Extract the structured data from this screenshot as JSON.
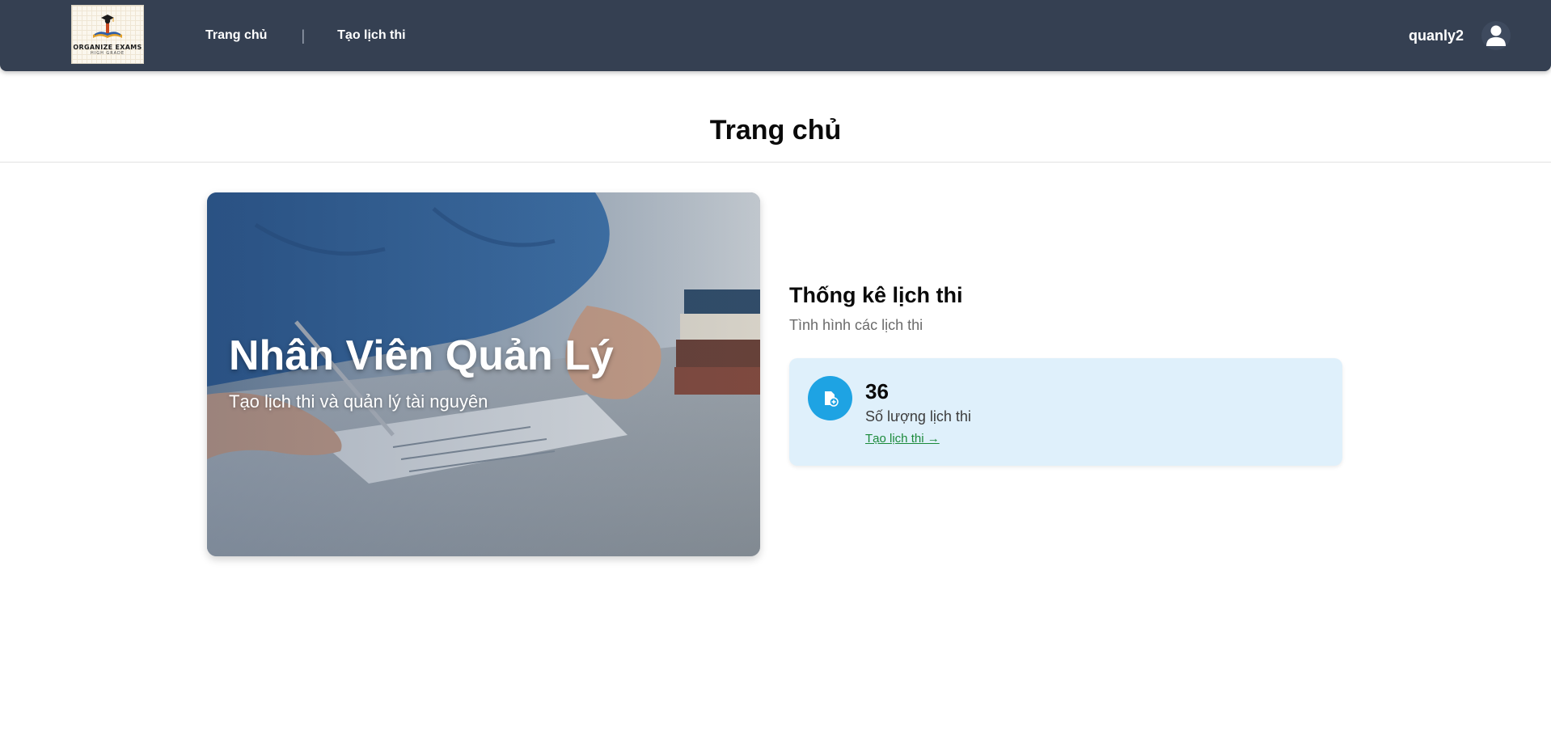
{
  "header": {
    "logo": {
      "title": "ORGANIZE EXAMS",
      "subtitle": "HIGH GRADE"
    },
    "nav": [
      {
        "label": "Trang chủ"
      },
      {
        "label": "Tạo lịch thi"
      }
    ],
    "separator": "|",
    "user": {
      "name": "quanly2",
      "icon": "user-icon"
    },
    "colors": {
      "background": "#354052",
      "text": "#ffffff"
    }
  },
  "page": {
    "title": "Trang chủ"
  },
  "hero": {
    "title": "Nhân Viên Quản Lý",
    "subtitle": "Tạo lịch thi và quản lý tài nguyên"
  },
  "stats": {
    "title": "Thống kê lịch thi",
    "subtitle": "Tình hình các lịch thi",
    "card": {
      "icon": "file-add-icon",
      "value": "36",
      "label": "Số lượng lịch thi",
      "link": "Tạo lịch thi →",
      "colors": {
        "background": "#dff0fb",
        "icon_bg": "#1ea3e3",
        "link": "#1b8a3a"
      }
    }
  }
}
